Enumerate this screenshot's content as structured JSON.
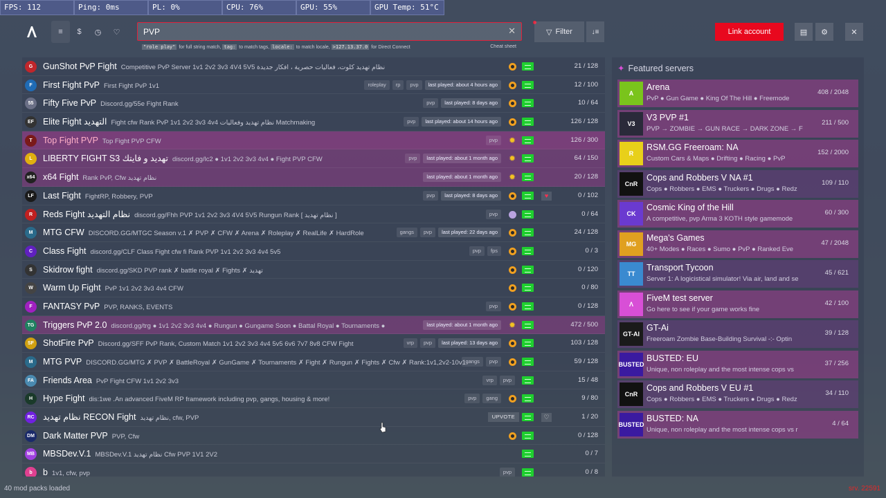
{
  "hud": [
    {
      "label": "FPS: 112",
      "w": 107
    },
    {
      "label": "Ping: 0ms",
      "w": 107
    },
    {
      "label": "PL: 0%",
      "w": 107
    },
    {
      "label": "CPU: 76%",
      "w": 107
    },
    {
      "label": "GPU: 55%",
      "w": 107
    },
    {
      "label": "GPU Temp: 51°C",
      "w": 107
    }
  ],
  "nav": {
    "icons": [
      "list-icon",
      "dollar-icon",
      "history-icon",
      "heart-icon"
    ]
  },
  "search": {
    "value": "PVP",
    "placeholder": ""
  },
  "hint": {
    "c1": "\"role play\"",
    "t1": "for full string match,",
    "c2": "tag:",
    "t2": "to match tags,",
    "c3": "locale:",
    "t3": "to match locale,",
    "c4": ">127.13.37.0",
    "t4": "for Direct Connect",
    "cheat": "Cheat sheet"
  },
  "toolbar": {
    "filter_label": "Filter",
    "link_label": "Link account"
  },
  "servers": [
    {
      "name": "GunShot PvP Fight",
      "desc": "Competitive PvP Server 1v1 2v2 3v3 4V4 5V5 نظام تهديد كلوت، فعاليات حصرية ، افكار جديدة",
      "tags": [],
      "status": "o",
      "count": "21 / 128",
      "icon": "#c0262b",
      "hl": "",
      "ic": "G"
    },
    {
      "name": "First Fight PvP",
      "desc": "First Fight PvP 1v1",
      "tags": [
        "roleplay",
        "rp",
        "pvp",
        "last played: about 4 hours ago"
      ],
      "status": "o",
      "count": "12 / 100",
      "icon": "#1f6bb5",
      "hl": "",
      "ic": "F"
    },
    {
      "name": "Fifty Five PvP",
      "desc": "Discord.gg/55e Fight Rank",
      "tags": [
        "pvp",
        "last played: 8 days ago"
      ],
      "status": "o",
      "count": "10 / 64",
      "icon": "#6a6f86",
      "hl": "",
      "ic": "55"
    },
    {
      "name": "Elite Fight التهديد",
      "desc": "Fight cfw Rank PvP 1v1 2v2 3v3 4v4 نظام تهديد وفعاليات Matchmaking",
      "tags": [
        "pvp",
        "last played: about 14 hours ago"
      ],
      "status": "o",
      "count": "126 / 128",
      "icon": "#333",
      "hl": "",
      "ic": "EF"
    },
    {
      "name": "Top Fight PVP",
      "desc": "Top Fight PVP CFW",
      "tags": [
        "pvp"
      ],
      "status": "s",
      "count": "126 / 300",
      "icon": "#7a1a1a",
      "hl": "hl",
      "ic": "T"
    },
    {
      "name": "LIBERTY FIGHT S3 تهديد و فايتك",
      "desc": "discord.gg/lc2 ● 1v1 2v2 3v3 4v4 ● Fight PVP CFW",
      "tags": [
        "pvp",
        "last played: about 1 month ago"
      ],
      "status": "s",
      "count": "64 / 150",
      "icon": "#e0b010",
      "hl": "hl2",
      "ic": "L"
    },
    {
      "name": "x64 Fight",
      "desc": "Rank PvP, Cfw نظام تهديد",
      "tags": [
        "last played: about 1 month ago"
      ],
      "status": "s",
      "count": "20 / 128",
      "icon": "#222",
      "hl": "hl2",
      "ic": "x64"
    },
    {
      "name": "Last Fight",
      "desc": "FightRP, Robbery, PVP",
      "tags": [
        "pvp",
        "last played: 8 days ago"
      ],
      "status": "o",
      "count": "0 / 102",
      "icon": "#1a1a1a",
      "hl": "",
      "ic": "LF",
      "heart": "red"
    },
    {
      "name": "Reds Fight نظام التهديد",
      "desc": "discord.gg/Fhh PVP 1v1 2v2 3v3 4V4 5V5 Rungun Rank [ نظام تهديد ]",
      "tags": [
        "pvp"
      ],
      "status": "p",
      "count": "0 / 64",
      "icon": "#c02020",
      "hl": "",
      "ic": "R"
    },
    {
      "name": "MTG CFW",
      "desc": "DISCORD.GG/MTGC Season v.1 ✗ PVP ✗ CFW ✗ Arena ✗ Roleplay ✗ RealLife ✗ HardRole",
      "tags": [
        "gangs",
        "pvp",
        "last played: 22 days ago"
      ],
      "status": "o",
      "count": "24 / 128",
      "icon": "#2a6a8a",
      "hl": "",
      "ic": "M"
    },
    {
      "name": "Class Fight",
      "desc": "discord.gg/CLF Class Fight cfw fi Rank PVP 1v1 2v2 3v3 4v4 5v5",
      "tags": [
        "pvp",
        "fps"
      ],
      "status": "o",
      "count": "0 / 3",
      "icon": "#6020c0",
      "hl": "",
      "ic": "C"
    },
    {
      "name": "Skidrow fight",
      "desc": "discord.gg/SKD PVP rank ✗ battle royal ✗ Fights ✗ تهديد",
      "tags": [],
      "status": "o",
      "count": "0 / 120",
      "icon": "#333",
      "hl": "",
      "ic": "S"
    },
    {
      "name": "Warm Up Fight",
      "desc": "PvP 1v1 2v2 3v3 4v4 CFW",
      "tags": [],
      "status": "o",
      "count": "0 / 80",
      "icon": "#444",
      "hl": "",
      "ic": "W"
    },
    {
      "name": "FANTASY PvP",
      "desc": "PVP, RANKS, EVENTS",
      "tags": [
        "pvp"
      ],
      "status": "o",
      "count": "0 / 128",
      "icon": "#a020c0",
      "hl": "",
      "ic": "F"
    },
    {
      "name": "Triggers PvP 2.0",
      "desc": "discord.gg/trg ● 1v1 2v2 3v3 4v4 ● Rungun ● Gungame Soon ● Battal Royal ● Tournaments ●",
      "tags": [
        "last played: about 1 month ago"
      ],
      "status": "s",
      "count": "472 / 500",
      "icon": "#208060",
      "hl": "hl2",
      "ic": "TG"
    },
    {
      "name": "ShotFire PvP",
      "desc": "Discord.gg/SFF PvP Rank, Custom Match 1v1 2v2 3v3 4v4 5v5 6v6 7v7 8v8 CFW Fight",
      "tags": [
        "vrp",
        "pvp",
        "last played: 13 days ago"
      ],
      "status": "o",
      "count": "103 / 128",
      "icon": "#d0a010",
      "hl": "",
      "ic": "SF"
    },
    {
      "name": "MTG PVP",
      "desc": "DISCORD.GG/MTG ✗ PVP ✗ BattleRoyal ✗ GunGame ✗ Tournaments ✗ Fight ✗ Rungun ✗ Fights ✗ Cfw ✗ Rank:1v1,2v2-10v1",
      "tags": [
        "gangs",
        "pvp"
      ],
      "status": "o",
      "count": "59 / 128",
      "icon": "#2a6a8a",
      "hl": "",
      "ic": "M"
    },
    {
      "name": "Friends Area",
      "desc": "PvP Fight CFW 1v1 2v2 3v3",
      "tags": [
        "vrp",
        "pvp"
      ],
      "status": "",
      "count": "15 / 48",
      "icon": "#4a8ab0",
      "hl": "",
      "ic": "FA"
    },
    {
      "name": "Hype Fight",
      "desc": "dis:1we .An advanced FiveM RP framework including pvp, gangs, housing & more!",
      "tags": [
        "pvp",
        "gang"
      ],
      "status": "o",
      "count": "9 / 80",
      "icon": "#1a3a2a",
      "hl": "",
      "ic": "H"
    },
    {
      "name": "نظام تهديد RECON Fight",
      "desc": "نظام تهديد, cfw, PVP",
      "tags": [],
      "status": "up",
      "count": "1 / 20",
      "icon": "#7020e0",
      "hl": "",
      "ic": "RC",
      "heart": "plain"
    },
    {
      "name": "Dark Matter PVP",
      "desc": "PVP, Cfw",
      "tags": [],
      "status": "o",
      "count": "0 / 128",
      "icon": "#1a2a6a",
      "hl": "",
      "ic": "DM"
    },
    {
      "name": "MBSDev.V.1",
      "desc": "MBSDev.V.1 نظام تهديد Cfw PVP 1V1 2V2",
      "tags": [],
      "status": "",
      "count": "0 / 7",
      "icon": "#a040e0",
      "hl": "",
      "ic": "MB"
    },
    {
      "name": "b",
      "desc": "1v1, cfw, pvp",
      "tags": [
        "pvp"
      ],
      "status": "",
      "count": "0 / 8",
      "icon": "#e04090",
      "hl": "",
      "ic": "b"
    }
  ],
  "upvote_label": "UPVOTE",
  "featured": {
    "title": "Featured servers",
    "items": [
      {
        "name": "Arena",
        "desc": "PvP ● Gun Game ● King Of The Hill ● Freemode",
        "count": "408 / 2048",
        "color": "#7ac41c",
        "abbr": "A",
        "dark": false
      },
      {
        "name": "V3 PVP #1",
        "desc": "PVP → ZOMBIE → GUN RACE → DARK ZONE → F",
        "count": "211 / 500",
        "color": "#2a2a3a",
        "abbr": "V3",
        "dark": false
      },
      {
        "name": "RSM.GG Freeroam: NA",
        "desc": "Custom Cars & Maps ● Drifting ● Racing ● PvP",
        "count": "152 / 2000",
        "color": "#e8d01a",
        "abbr": "R",
        "dark": false
      },
      {
        "name": "Cops and Robbers V NA #1",
        "desc": "Cops ● Robbers ● EMS ● Truckers ● Drugs ● Redz",
        "count": "109 / 110",
        "color": "#111",
        "abbr": "CnR",
        "dark": true
      },
      {
        "name": "Cosmic King of the Hill",
        "desc": "A competitive, pvp Arma 3 KOTH style gamemode",
        "count": "60 / 300",
        "color": "#6a3ad0",
        "abbr": "CK",
        "dark": false
      },
      {
        "name": "Mega's Games",
        "desc": "40+ Modes ● Races ● Sumo ● PvP ● Ranked Eve",
        "count": "47 / 2048",
        "color": "#e0a020",
        "abbr": "MG",
        "dark": false
      },
      {
        "name": "Transport Tycoon",
        "desc": "Server 1: A logicistical simulator! Via air, land and se",
        "count": "45 / 621",
        "color": "#3a8ad0",
        "abbr": "TT",
        "dark": true
      },
      {
        "name": "FiveM test server",
        "desc": "Go here to see if your game works fine",
        "count": "42 / 100",
        "color": "#d84fd6",
        "abbr": "Λ",
        "dark": false
      },
      {
        "name": "GT-Ai",
        "desc": "Freeroam Zombie Base-Building Survival -:- Optin",
        "count": "39 / 128",
        "color": "#1a1a1a",
        "abbr": "GT-AI",
        "dark": true
      },
      {
        "name": "BUSTED: EU",
        "desc": "Unique, non roleplay and the most intense cops vs",
        "count": "37 / 256",
        "color": "#3a1aa0",
        "abbr": "BUSTED",
        "dark": false
      },
      {
        "name": "Cops and Robbers V EU #1",
        "desc": "Cops ● Robbers ● EMS ● Truckers ● Drugs ● Redz",
        "count": "34 / 110",
        "color": "#111",
        "abbr": "CnR",
        "dark": true
      },
      {
        "name": "BUSTED: NA",
        "desc": "Unique, non roleplay and the most intense cops vs r",
        "count": "4 / 64",
        "color": "#3a1aa0",
        "abbr": "BUSTED",
        "dark": false
      }
    ]
  },
  "footer": {
    "status": "40 mod packs loaded",
    "build": "srv. 22591"
  }
}
